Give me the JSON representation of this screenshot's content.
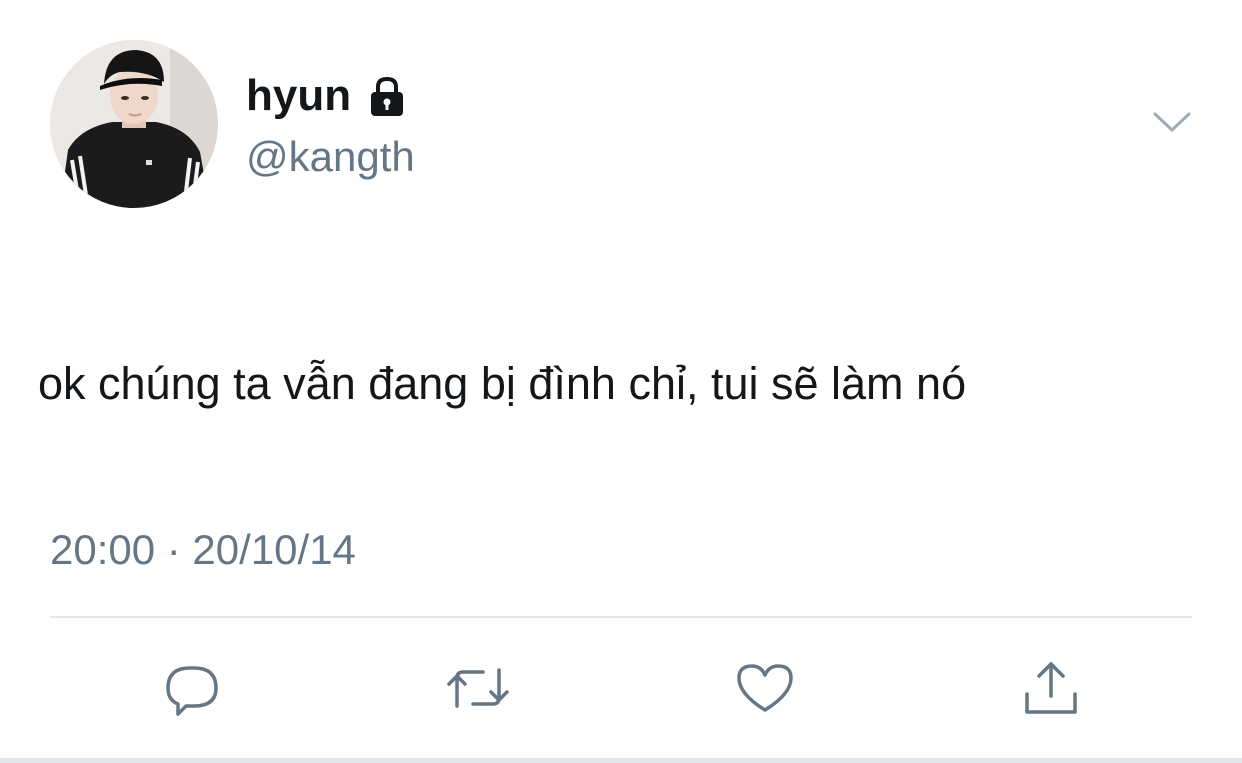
{
  "tweet": {
    "author": {
      "display_name": "hyun",
      "handle": "@kangth",
      "protected_icon": "lock-icon",
      "avatar": "profile-photo"
    },
    "text": "ok chúng ta vẫn đang bị đình chỉ, tui sẽ làm nó",
    "timestamp": "20:00 · 20/10/14",
    "menu_icon": "chevron-down-icon",
    "actions": [
      {
        "name": "reply",
        "icon": "speech-bubble-icon"
      },
      {
        "name": "retweet",
        "icon": "retweet-icon"
      },
      {
        "name": "like",
        "icon": "heart-icon"
      },
      {
        "name": "share",
        "icon": "share-icon"
      }
    ]
  },
  "colors": {
    "text": "#14171a",
    "secondary": "#657786",
    "divider": "#e1e8ed"
  }
}
